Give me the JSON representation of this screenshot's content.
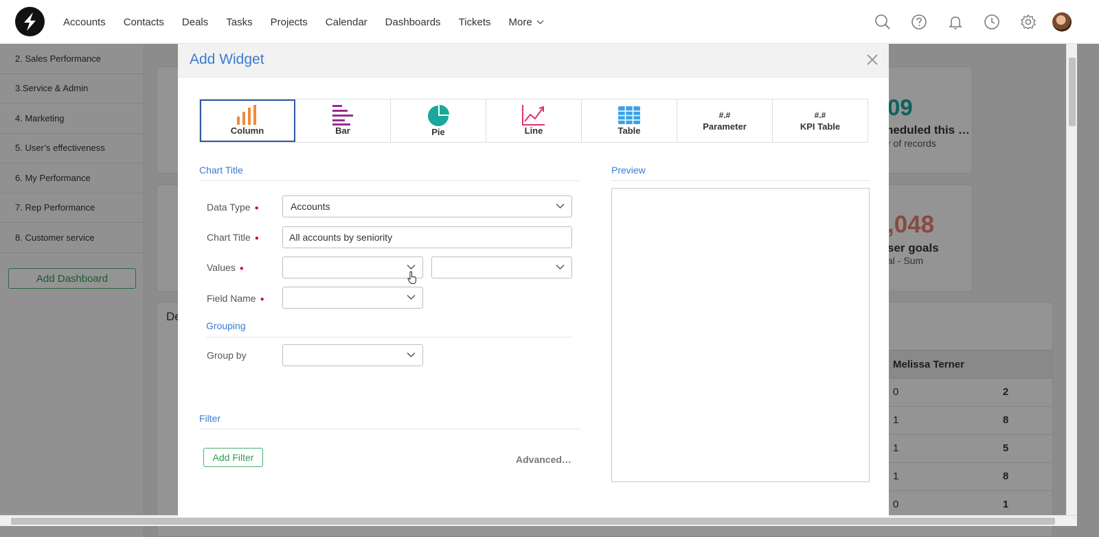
{
  "nav": {
    "items": [
      "Accounts",
      "Contacts",
      "Deals",
      "Tasks",
      "Projects",
      "Calendar",
      "Dashboards",
      "Tickets",
      "More"
    ]
  },
  "sidebar": {
    "items": [
      "2. Sales Performance",
      "3.Service & Admin",
      "4. Marketing",
      "5. User’s effectiveness",
      "6. My Performance",
      "7. Rep Performance",
      "8. Customer service"
    ],
    "add_dashboard": "Add Dashboard"
  },
  "background": {
    "kpi1_value": "09",
    "kpi1_label": "heduled this …",
    "kpi1_sub": "r of records",
    "kpi2_value": ",048",
    "kpi2_label": "ser goals",
    "kpi2_sub": "al - Sum",
    "card_title": "De",
    "table_header": "Melissa Terner",
    "table_rows": [
      [
        "0",
        "2"
      ],
      [
        "1",
        "8"
      ],
      [
        "1",
        "5"
      ],
      [
        "1",
        "8"
      ],
      [
        "0",
        "1"
      ]
    ]
  },
  "modal": {
    "title": "Add Widget",
    "types": [
      {
        "label": "Column",
        "icon": "column-chart-icon",
        "active": true
      },
      {
        "label": "Bar",
        "icon": "bar-chart-icon"
      },
      {
        "label": "Pie",
        "icon": "pie-chart-icon"
      },
      {
        "label": "Line",
        "icon": "line-chart-icon"
      },
      {
        "label": "Table",
        "icon": "table-icon"
      },
      {
        "label": "Parameter",
        "hash": "#.#"
      },
      {
        "label": "KPI Table",
        "hash": "#.#"
      }
    ],
    "chart_title_section": "Chart Title",
    "preview_section": "Preview",
    "fields": {
      "data_type_label": "Data Type",
      "data_type_value": "Accounts",
      "chart_title_label": "Chart Title",
      "chart_title_value": "All accounts by seniority",
      "values_label": "Values",
      "field_name_label": "Field Name"
    },
    "grouping_section": "Grouping",
    "group_by_label": "Group by",
    "filter_section": "Filter",
    "add_filter": "Add Filter",
    "advanced": "Advanced…"
  },
  "colors": {
    "accent": "#3b7bd0",
    "green": "#4ab070",
    "column_icon": "#f08a3c",
    "bar_icon": "#9b2a8f",
    "pie_icon": "#1aa89c",
    "line_icon": "#e0306a",
    "table_icon": "#3aa3e8"
  }
}
